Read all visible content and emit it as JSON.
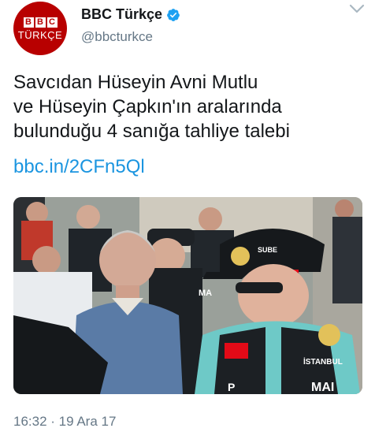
{
  "account": {
    "display_name": "BBC Türkçe",
    "handle": "@bbcturkce",
    "avatar_letters": [
      "B",
      "B",
      "C"
    ],
    "avatar_word": "TÜRKÇE",
    "verified_icon": "verified-badge-icon"
  },
  "tweet": {
    "lines": [
      "Savcıdan Hüseyin Avni Mutlu",
      "ve Hüseyin Çapkın'ın aralarında",
      "bulunduğu 4 sanığa tahliye talebi"
    ],
    "link": "bbc.in/2CFn5Ql",
    "photo_labels": {
      "cap_patch": "SUBE",
      "vest_mark": "MA",
      "city": "İSTANBUL",
      "vest_bottom": "MAI",
      "vest_letter": "P"
    },
    "timestamp": "16:32 · 19 Ara 17"
  },
  "colors": {
    "text": "#14171a",
    "secondary": "#657786",
    "link": "#1b95e0",
    "verified": "#1da1f2",
    "bbc_red": "#b80000"
  }
}
